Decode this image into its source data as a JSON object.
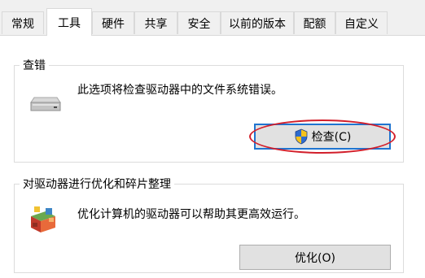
{
  "tabs": [
    {
      "label": "常规"
    },
    {
      "label": "工具"
    },
    {
      "label": "硬件"
    },
    {
      "label": "共享"
    },
    {
      "label": "安全"
    },
    {
      "label": "以前的版本"
    },
    {
      "label": "配额"
    },
    {
      "label": "自定义"
    }
  ],
  "active_tab": "工具",
  "check_group": {
    "title": "查错",
    "description": "此选项将检查驱动器中的文件系统错误。",
    "button_label": "检查(C)",
    "icon": "drive-icon",
    "button_icon": "uac-shield-icon"
  },
  "optimize_group": {
    "title": "对驱动器进行优化和碎片整理",
    "description": "优化计算机的驱动器可以帮助其更高效运行。",
    "button_label": "优化(O)",
    "icon": "defrag-icon"
  },
  "colors": {
    "focus_border": "#1f74d0",
    "annotation_red": "#d21f2b",
    "tab_bg": "#f0f0f0",
    "button_bg": "#e1e1e1"
  }
}
